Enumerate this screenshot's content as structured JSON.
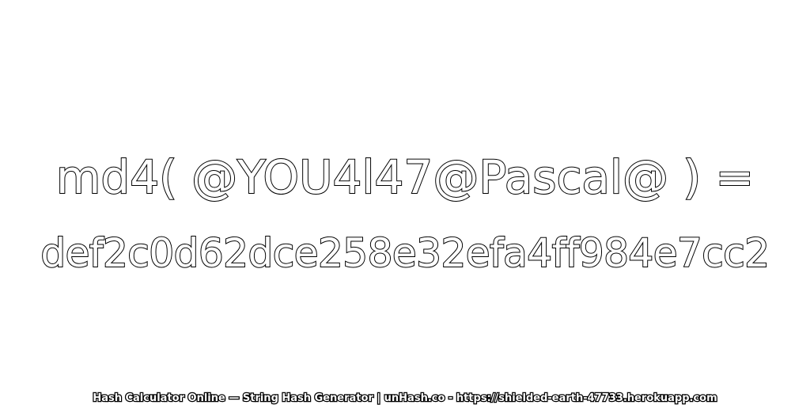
{
  "expression": "md4( @YOU4l47@Pascal@ ) =",
  "hash_result": "def2c0d62dce258e32efa4ff984e7cc2",
  "footer": "Hash Calculator Online — String Hash Generator | unHash.co - https://shielded-earth-47733.herokuapp.com",
  "colors": {
    "background": "#ffffff",
    "text_fill": "#ffffff",
    "text_outline": "#000000"
  }
}
